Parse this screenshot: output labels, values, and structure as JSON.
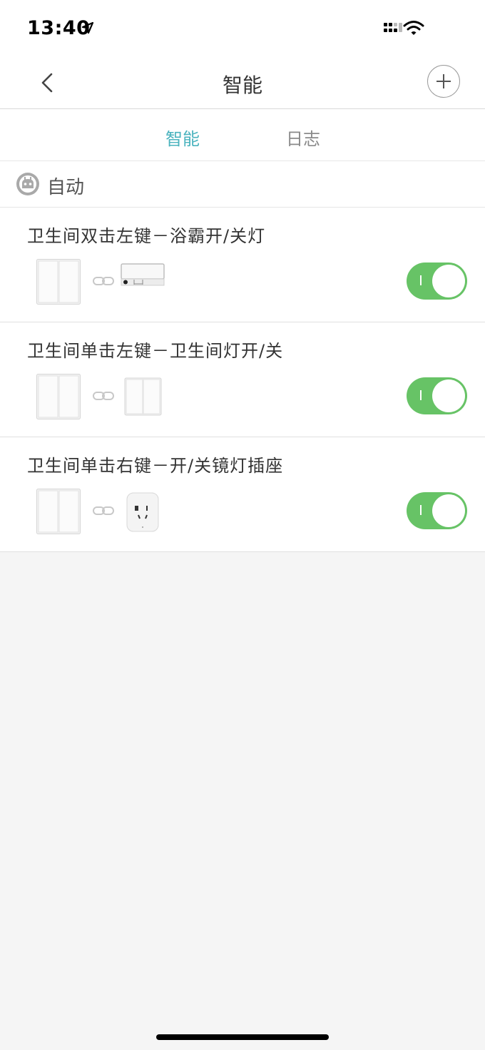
{
  "status": {
    "time": "13:40"
  },
  "nav": {
    "title": "智能"
  },
  "tabs": [
    {
      "label": "智能",
      "active": true
    },
    {
      "label": "日志",
      "active": false
    }
  ],
  "section": {
    "label": "自动"
  },
  "rules": [
    {
      "title": "卫生间双击左键－浴霸开/关灯",
      "target_device": "bath-heater",
      "enabled": true
    },
    {
      "title": "卫生间单击左键－卫生间灯开/关",
      "target_device": "wall-switch",
      "enabled": true
    },
    {
      "title": "卫生间单击右键－开/关镜灯插座",
      "target_device": "smart-plug",
      "enabled": true
    }
  ],
  "colors": {
    "accent": "#4ab3be",
    "toggle_on": "#67c366",
    "background": "#f5f5f5"
  }
}
